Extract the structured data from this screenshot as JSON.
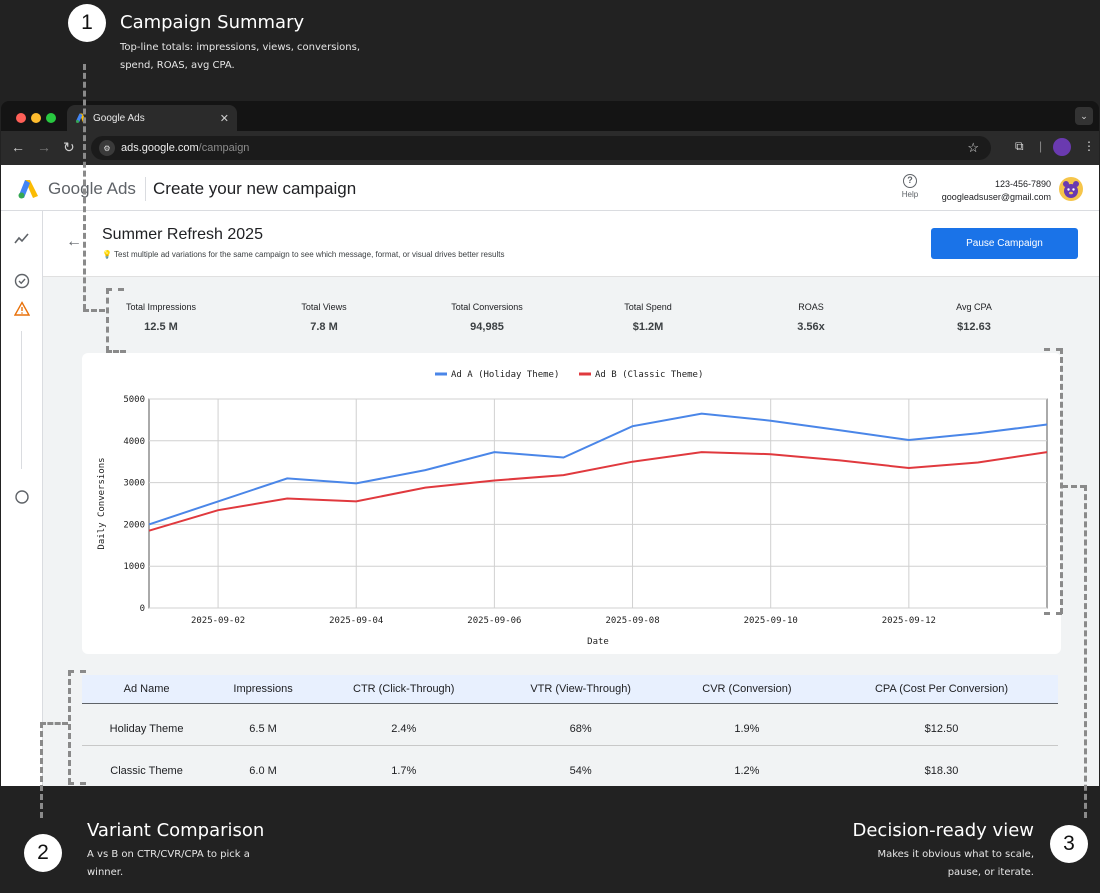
{
  "annotations": [
    {
      "num": "1",
      "title": "Campaign Summary",
      "desc": "Top-line totals: impressions, views, conversions, spend, ROAS, avg CPA."
    },
    {
      "num": "2",
      "title": "Variant Comparison",
      "desc": "A vs B on CTR/CVR/CPA to pick a winner."
    },
    {
      "num": "3",
      "title": "Decision-ready view",
      "desc": "Makes it obvious what to scale, pause, or iterate."
    }
  ],
  "browser": {
    "tab_title": "Google Ads",
    "url_host": "ads.google.com",
    "url_path": "/campaign"
  },
  "header": {
    "brand": "Google Ads",
    "page_title": "Create your new campaign",
    "help_label": "Help",
    "phone": "123-456-7890",
    "email": "googleadsuser@gmail.com"
  },
  "campaign": {
    "name": "Summer Refresh 2025",
    "tip": "Test multiple ad variations for the same campaign to see which message, format, or visual drives better results",
    "pause_label": "Pause Campaign"
  },
  "kpis": [
    {
      "label": "Total Impressions",
      "value": "12.5 M"
    },
    {
      "label": "Total Views",
      "value": "7.8 M"
    },
    {
      "label": "Total Conversions",
      "value": "94,985"
    },
    {
      "label": "Total Spend",
      "value": "$1.2M"
    },
    {
      "label": "ROAS",
      "value": "3.56x"
    },
    {
      "label": "Avg CPA",
      "value": "$12.63"
    }
  ],
  "chart_data": {
    "type": "line",
    "title": "",
    "xlabel": "Date",
    "ylabel": "Daily Conversions",
    "x": [
      "2025-09-01",
      "2025-09-02",
      "2025-09-03",
      "2025-09-04",
      "2025-09-05",
      "2025-09-06",
      "2025-09-07",
      "2025-09-08",
      "2025-09-09",
      "2025-09-10",
      "2025-09-11",
      "2025-09-12",
      "2025-09-13",
      "2025-09-14"
    ],
    "x_tick_labels": [
      "2025-09-02",
      "2025-09-04",
      "2025-09-06",
      "2025-09-08",
      "2025-09-10",
      "2025-09-12"
    ],
    "ylim": [
      0,
      5000
    ],
    "y_ticks": [
      "0",
      "1000",
      "2000",
      "3000",
      "4000",
      "5000"
    ],
    "grid": true,
    "legend": "top-center",
    "series": [
      {
        "name": "Ad A (Holiday Theme)",
        "color": "#4a86e8",
        "values": [
          2000,
          2550,
          3100,
          2980,
          3300,
          3730,
          3600,
          4350,
          4650,
          4480,
          4250,
          4020,
          4180,
          4390
        ]
      },
      {
        "name": "Ad B (Classic Theme)",
        "color": "#e0393e",
        "values": [
          1850,
          2340,
          2620,
          2550,
          2880,
          3050,
          3180,
          3500,
          3730,
          3680,
          3530,
          3350,
          3480,
          3730
        ]
      }
    ]
  },
  "comparison": {
    "headers": [
      "Ad Name",
      "Impressions",
      "CTR (Click-Through)",
      "VTR (View-Through)",
      "CVR (Conversion)",
      "CPA (Cost Per Conversion)"
    ],
    "rows": [
      [
        "Holiday Theme",
        "6.5 M",
        "2.4%",
        "68%",
        "1.9%",
        "$12.50"
      ],
      [
        "Classic Theme",
        "6.0 M",
        "1.7%",
        "54%",
        "1.2%",
        "$18.30"
      ]
    ]
  }
}
